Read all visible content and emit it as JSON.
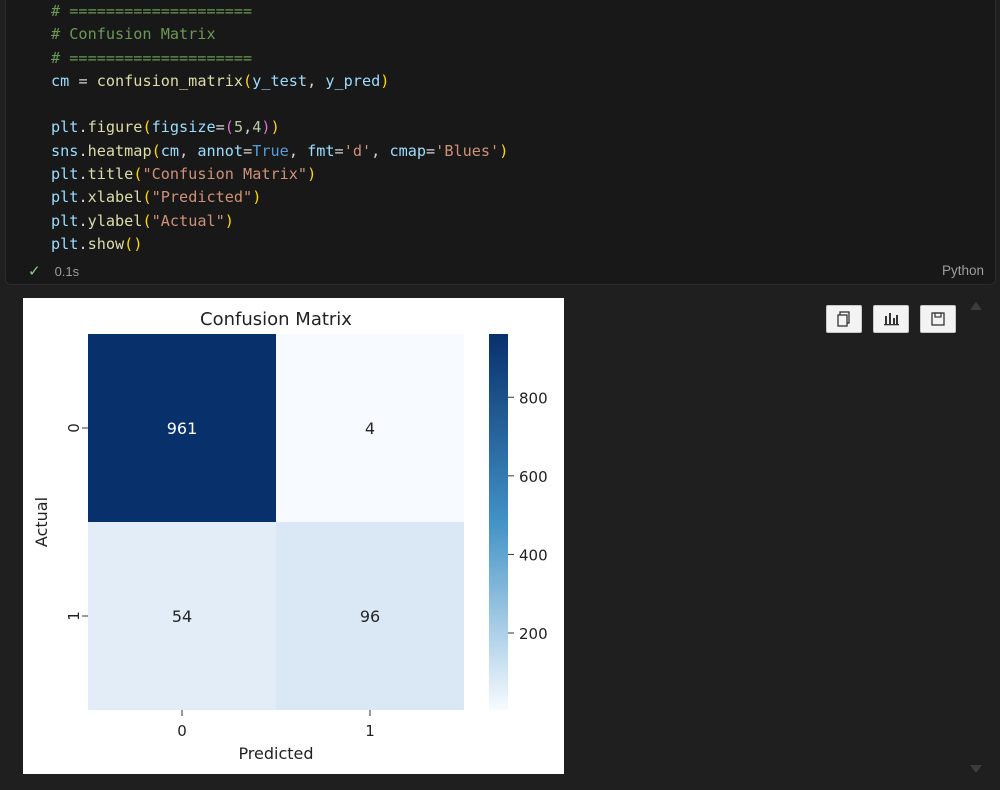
{
  "code_cell": {
    "lines": [
      [
        [
          "c-cmt",
          "# ===================="
        ]
      ],
      [
        [
          "c-cmt",
          "# Confusion Matrix"
        ]
      ],
      [
        [
          "c-cmt",
          "# ===================="
        ]
      ],
      [
        [
          "c-var",
          "cm"
        ],
        [
          "c-txt",
          " = "
        ],
        [
          "c-fn",
          "confusion_matrix"
        ],
        [
          "c-p1",
          "("
        ],
        [
          "c-var",
          "y_test"
        ],
        [
          "c-txt",
          ", "
        ],
        [
          "c-var",
          "y_pred"
        ],
        [
          "c-p1",
          ")"
        ]
      ],
      [],
      [
        [
          "c-var",
          "plt"
        ],
        [
          "c-txt",
          "."
        ],
        [
          "c-fn",
          "figure"
        ],
        [
          "c-p1",
          "("
        ],
        [
          "c-var",
          "figsize"
        ],
        [
          "c-txt",
          "="
        ],
        [
          "c-p2",
          "("
        ],
        [
          "c-num",
          "5"
        ],
        [
          "c-txt",
          ","
        ],
        [
          "c-num",
          "4"
        ],
        [
          "c-p2",
          ")"
        ],
        [
          "c-p1",
          ")"
        ]
      ],
      [
        [
          "c-var",
          "sns"
        ],
        [
          "c-txt",
          "."
        ],
        [
          "c-fn",
          "heatmap"
        ],
        [
          "c-p1",
          "("
        ],
        [
          "c-var",
          "cm"
        ],
        [
          "c-txt",
          ", "
        ],
        [
          "c-var",
          "annot"
        ],
        [
          "c-txt",
          "="
        ],
        [
          "c-kw",
          "True"
        ],
        [
          "c-txt",
          ", "
        ],
        [
          "c-var",
          "fmt"
        ],
        [
          "c-txt",
          "="
        ],
        [
          "c-str",
          "'d'"
        ],
        [
          "c-txt",
          ", "
        ],
        [
          "c-var",
          "cmap"
        ],
        [
          "c-txt",
          "="
        ],
        [
          "c-str",
          "'Blues'"
        ],
        [
          "c-p1",
          ")"
        ]
      ],
      [
        [
          "c-var",
          "plt"
        ],
        [
          "c-txt",
          "."
        ],
        [
          "c-fn",
          "title"
        ],
        [
          "c-p1",
          "("
        ],
        [
          "c-str",
          "\"Confusion Matrix\""
        ],
        [
          "c-p1",
          ")"
        ]
      ],
      [
        [
          "c-var",
          "plt"
        ],
        [
          "c-txt",
          "."
        ],
        [
          "c-fn",
          "xlabel"
        ],
        [
          "c-p1",
          "("
        ],
        [
          "c-str",
          "\"Predicted\""
        ],
        [
          "c-p1",
          ")"
        ]
      ],
      [
        [
          "c-var",
          "plt"
        ],
        [
          "c-txt",
          "."
        ],
        [
          "c-fn",
          "ylabel"
        ],
        [
          "c-p1",
          "("
        ],
        [
          "c-str",
          "\"Actual\""
        ],
        [
          "c-p1",
          ")"
        ]
      ],
      [
        [
          "c-var",
          "plt"
        ],
        [
          "c-txt",
          "."
        ],
        [
          "c-fn",
          "show"
        ],
        [
          "c-p1",
          "()"
        ]
      ]
    ],
    "status": {
      "check_icon": "check-icon",
      "time": "0.1s"
    },
    "language": "Python"
  },
  "output_toolbar": {
    "buttons": [
      {
        "name": "copy-output-button",
        "icon": "copy-icon"
      },
      {
        "name": "open-chart-button",
        "icon": "chart-icon"
      },
      {
        "name": "save-output-button",
        "icon": "save-icon"
      }
    ]
  },
  "chart_data": {
    "type": "heatmap",
    "title": "Confusion Matrix",
    "xlabel": "Predicted",
    "ylabel": "Actual",
    "x_categories": [
      "0",
      "1"
    ],
    "y_categories": [
      "0",
      "1"
    ],
    "values": [
      [
        961,
        4
      ],
      [
        54,
        96
      ]
    ],
    "colormap": "Blues",
    "colorbar": {
      "ticks": [
        200,
        400,
        600,
        800
      ],
      "range": [
        4,
        961
      ]
    },
    "colors": {
      "cell_0_0": "#08306b",
      "cell_0_1": "#f7fbff",
      "cell_1_0": "#e2edf8",
      "cell_1_1": "#dae8f6",
      "bar_top": "#08306b",
      "bar_mid": "#4292c6",
      "bar_bottom": "#f7fbff"
    }
  }
}
